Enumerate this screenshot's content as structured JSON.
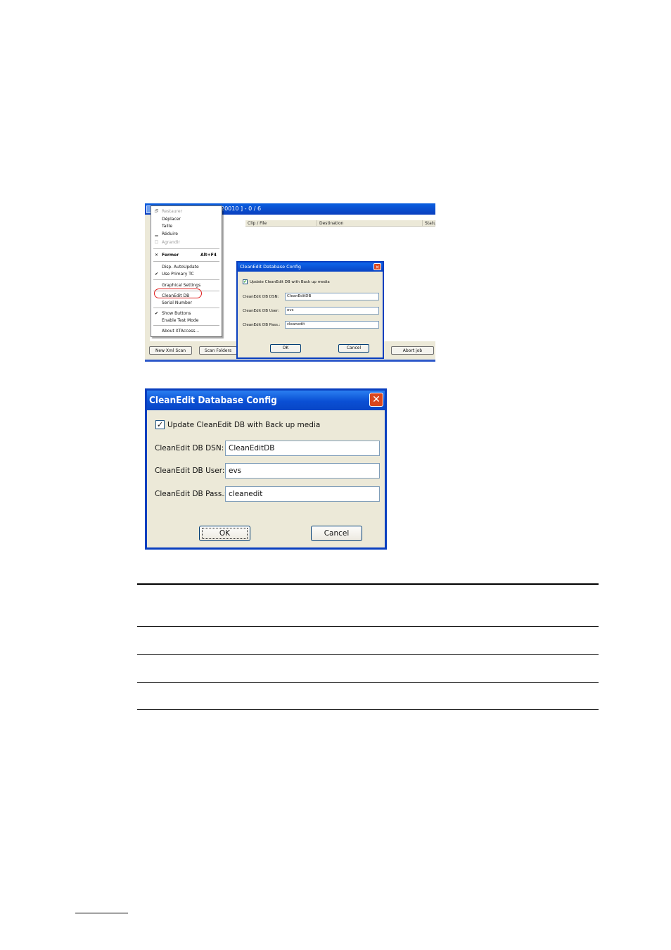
{
  "screenshot1": {
    "window_title_fragment": "20010 ] - 0 / 6",
    "columns": [
      "Clip / File",
      "Destination",
      "Statu"
    ],
    "buttons": {
      "new_xml_scan": "New Xml Scan",
      "scan_folders": "Scan Folders",
      "abort_job": "Abort job"
    },
    "context_menu": {
      "items": {
        "restaurer": "Restaurer",
        "deplacer": "Déplacer",
        "taille": "Taille",
        "reduire": "Réduire",
        "agrandir": "Agrandir",
        "fermer": "Fermer",
        "fermer_accel": "Alt+F4",
        "disp_autoupdate": "Disp. AutoUpdate",
        "use_primary_tc": "Use Primary TC",
        "graphical_settings": "Graphical Settings",
        "cleanedit_db": "CleanEdit DB",
        "serial_number": "Serial Number",
        "show_buttons": "Show Buttons",
        "enable_test_mode": "Enable Test Mode",
        "about": "About XTAccess..."
      },
      "highlight_color": "#e02020"
    },
    "dialog": {
      "title": "CleanEdit Database Config",
      "checkbox_label": "Update CleanEdit DB with Back up media",
      "dsn_label": "CleanEdit DB DSN:",
      "dsn_value": "CleanEditDB",
      "user_label": "CleanEdit DB User:",
      "user_value": "evs",
      "pass_label": "CleanEdit DB Pass.:",
      "pass_value": "cleanedit",
      "ok_label": "OK",
      "cancel_label": "Cancel"
    }
  },
  "dialog_large": {
    "title": "CleanEdit Database Config",
    "close_glyph": "✕",
    "checkbox_checked": true,
    "checkbox_label": "Update CleanEdit DB with Back up media",
    "fields": {
      "dsn_label": "CleanEdit DB DSN:",
      "dsn_value": "CleanEditDB",
      "user_label": "CleanEdit DB User:",
      "user_value": "evs",
      "pass_label": "CleanEdit DB Pass.:",
      "pass_value": "cleanedit"
    },
    "ok_label": "OK",
    "cancel_label": "Cancel"
  },
  "colors": {
    "title_bar_blue": "#0a4fd4",
    "dialog_background": "#ece9d8",
    "close_button_red": "#d9471e"
  },
  "icons": [
    "close-icon",
    "checkmark-icon",
    "window-menu-icon"
  ]
}
